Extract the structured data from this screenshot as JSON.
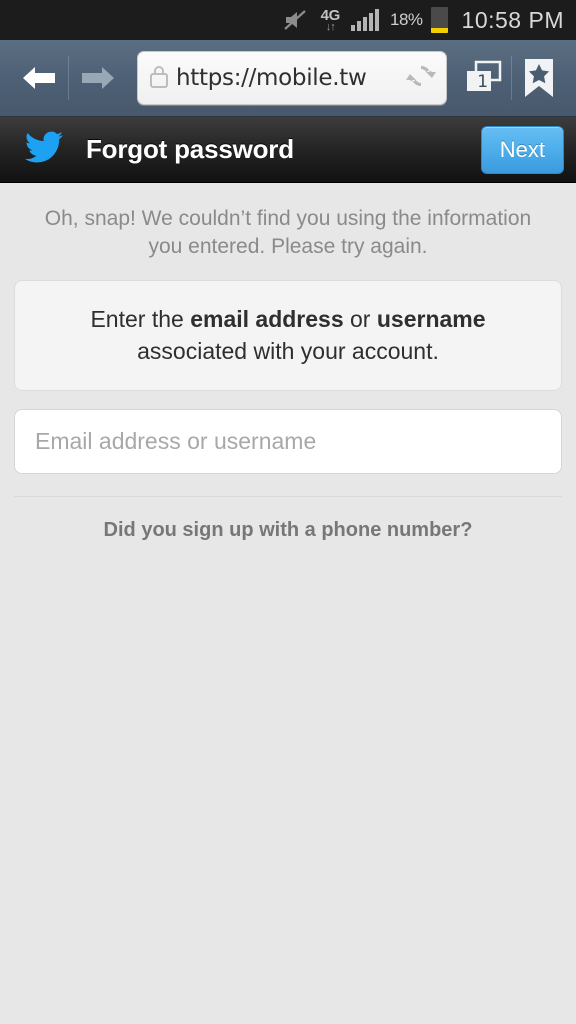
{
  "status_bar": {
    "mute_icon": "speaker-muted-icon",
    "network_label": "4G",
    "network_arrows": "↓↑",
    "signal_icon": "signal-bars-icon",
    "battery_percent": "18%",
    "battery_level": 18,
    "clock": "10:58 PM"
  },
  "browser": {
    "back_icon": "back-arrow-icon",
    "forward_icon": "forward-arrow-icon",
    "lock_icon": "lock-icon",
    "url": "https://mobile.tw",
    "refresh_icon": "refresh-icon",
    "tab_count": "1",
    "bookmark_icon": "bookmark-star-icon"
  },
  "app_header": {
    "logo": "twitter-bird-icon",
    "title": "Forgot password",
    "next_label": "Next",
    "accent_color": "#4fb0ec",
    "logo_color": "#1da1f2"
  },
  "content": {
    "error_message": "Oh, snap! We couldn’t find you using the information you entered. Please try again.",
    "instruction": {
      "part1": "Enter the ",
      "bold1": "email address",
      "part2": " or ",
      "bold2": "username",
      "part3": " associated with your account."
    },
    "input_placeholder": "Email address or username",
    "input_value": "",
    "phone_link": "Did you sign up with a phone number?"
  }
}
